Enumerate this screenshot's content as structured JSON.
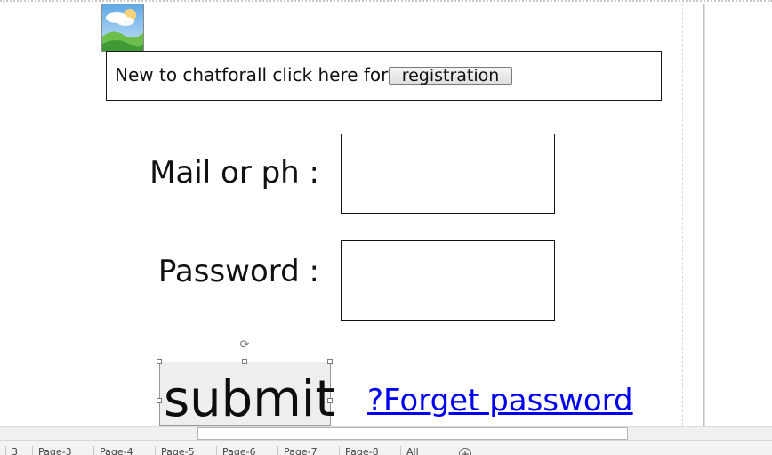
{
  "registration_banner": {
    "text": "New to chatforall click here for",
    "button_label": "registration"
  },
  "form": {
    "mail_label": "Mail or ph :",
    "mail_value": "",
    "password_label": "Password :",
    "password_value": ""
  },
  "actions": {
    "submit_label": "submit",
    "forget_password_link": "?Forget password"
  },
  "icons": {
    "picture": "picture-icon",
    "rotate": "rotate-handle-icon",
    "add_page": "add-page-icon"
  },
  "page_tabs": [
    "3",
    "Page-3",
    "Page-4",
    "Page-5",
    "Page-6",
    "Page-7",
    "Page-8",
    "All"
  ],
  "colors": {
    "link": "#0000ee",
    "border": "#111111",
    "submit_background": "#eeeeee"
  }
}
